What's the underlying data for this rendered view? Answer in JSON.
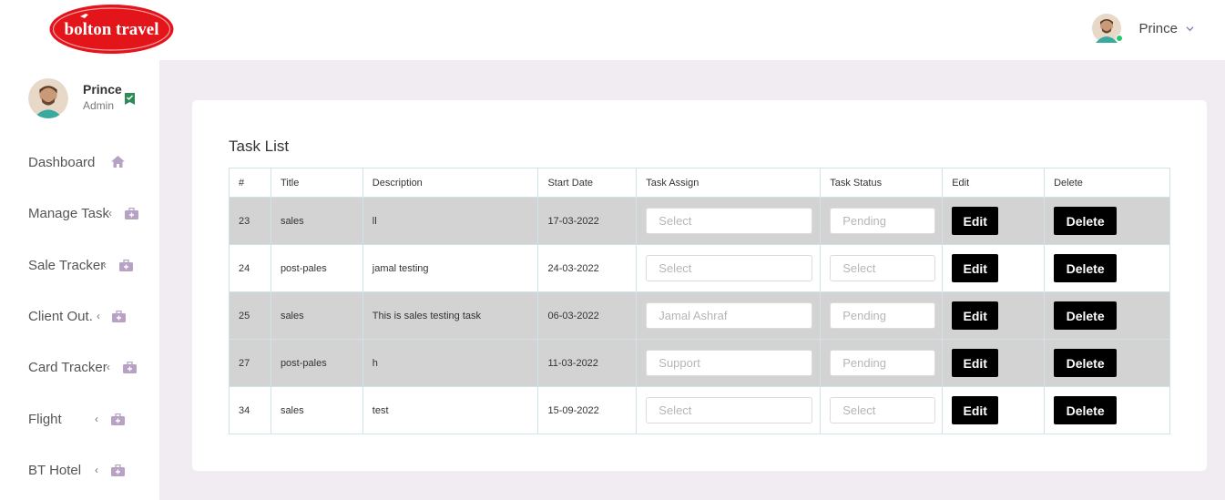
{
  "brand": {
    "logo_text": "bolton travel",
    "logo_color": "#e4141b"
  },
  "header": {
    "user_name": "Prince"
  },
  "sidebar": {
    "profile": {
      "name": "Prince",
      "role": "Admin"
    },
    "items": [
      {
        "label": "Dashboard",
        "icon": "home-icon",
        "has_chevron": false
      },
      {
        "label": "Manage Task",
        "icon": "briefcase-plus-icon",
        "has_chevron": true
      },
      {
        "label": "Sale Tracker",
        "icon": "briefcase-plus-icon",
        "has_chevron": true
      },
      {
        "label": "Client Out.",
        "icon": "briefcase-plus-icon",
        "has_chevron": true
      },
      {
        "label": "Card Tracker",
        "icon": "briefcase-plus-icon",
        "has_chevron": true
      },
      {
        "label": "Flight",
        "icon": "briefcase-plus-icon",
        "has_chevron": true
      },
      {
        "label": "BT Hotel",
        "icon": "briefcase-plus-icon",
        "has_chevron": true
      }
    ]
  },
  "main": {
    "title": "Task List",
    "columns": [
      "#",
      "Title",
      "Description",
      "Start Date",
      "Task Assign",
      "Task Status",
      "Edit",
      "Delete"
    ],
    "rows": [
      {
        "id": "23",
        "title": "sales",
        "description": "ll",
        "start_date": "17-03-2022",
        "assign": "Select",
        "status": "Pending",
        "shaded": true
      },
      {
        "id": "24",
        "title": "post-pales",
        "description": "jamal testing",
        "start_date": "24-03-2022",
        "assign": "Select",
        "status": "Select",
        "shaded": false
      },
      {
        "id": "25",
        "title": "sales",
        "description": "This is sales testing task",
        "start_date": "06-03-2022",
        "assign": "Jamal Ashraf",
        "status": "Pending",
        "shaded": true
      },
      {
        "id": "27",
        "title": "post-pales",
        "description": "h",
        "start_date": "11-03-2022",
        "assign": "Support",
        "status": "Pending",
        "shaded": true
      },
      {
        "id": "34",
        "title": "sales",
        "description": "test",
        "start_date": "15-09-2022",
        "assign": "Select",
        "status": "Select",
        "shaded": false
      }
    ],
    "edit_label": "Edit",
    "delete_label": "Delete"
  }
}
